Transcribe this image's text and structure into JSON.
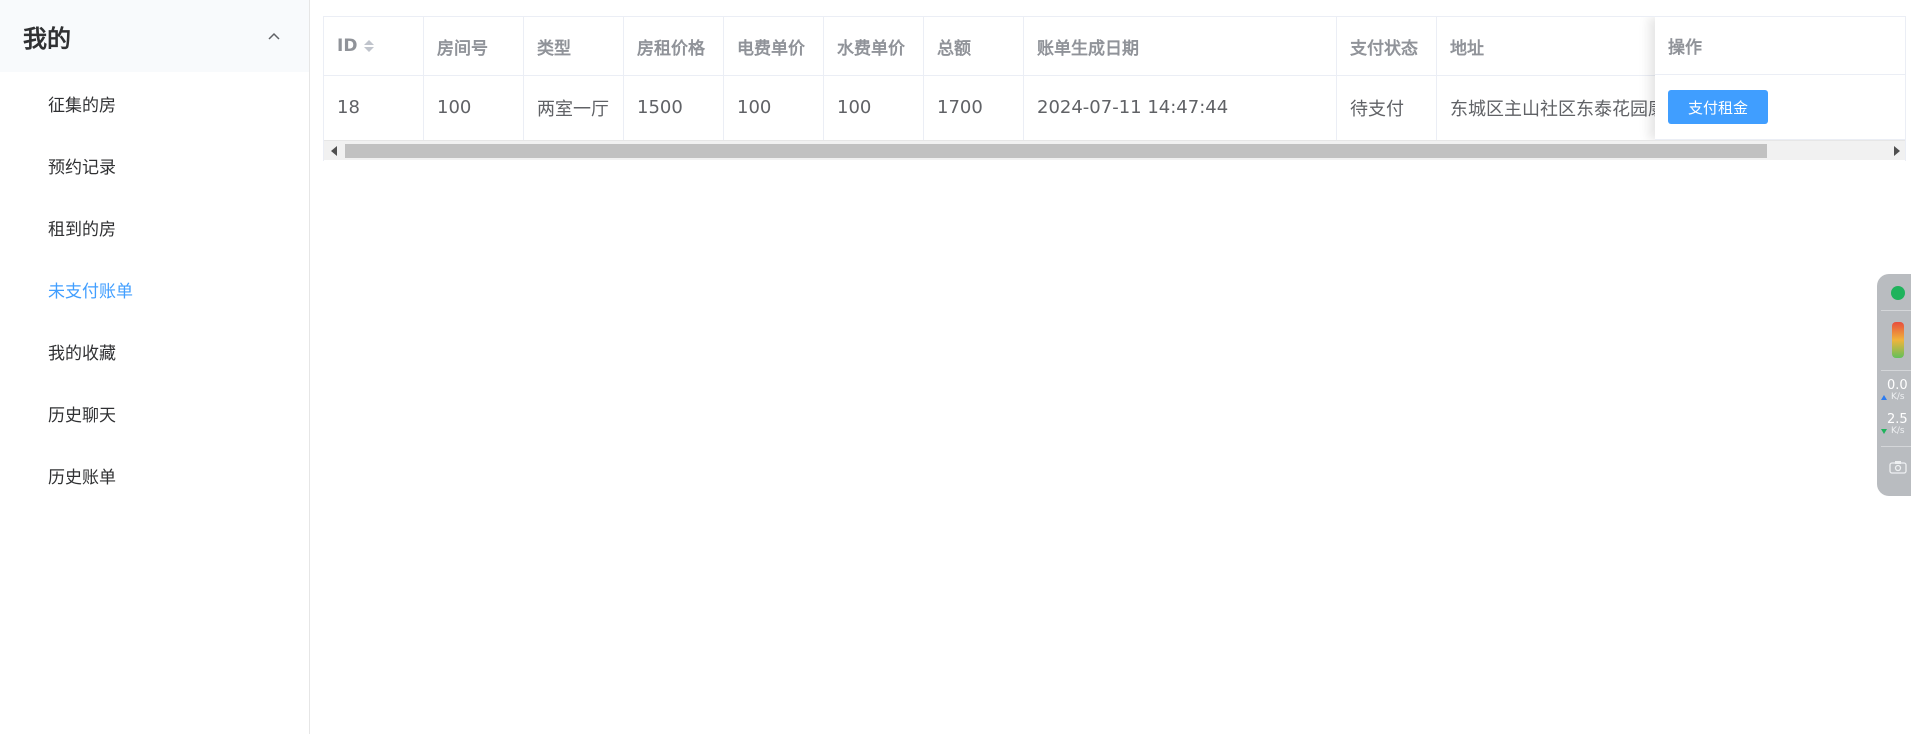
{
  "sidebar": {
    "title": "我的",
    "items": [
      {
        "label": "征集的房"
      },
      {
        "label": "预约记录"
      },
      {
        "label": "租到的房"
      },
      {
        "label": "未支付账单"
      },
      {
        "label": "我的收藏"
      },
      {
        "label": "历史聊天"
      },
      {
        "label": "历史账单"
      }
    ],
    "active_item": "未支付账单"
  },
  "table": {
    "headers": [
      "ID",
      "房间号",
      "类型",
      "房租价格",
      "电费单价",
      "水费单价",
      "总额",
      "账单生成日期",
      "支付状态",
      "地址",
      "操作"
    ],
    "rows": [
      {
        "cells": [
          "18",
          "100",
          "两室一厅",
          "1500",
          "100",
          "100",
          "1700",
          "2024-07-11 14:47:44",
          "待支付",
          "东城区主山社区东泰花园康"
        ],
        "action_label": "支付租金"
      }
    ],
    "sortable_column": "ID"
  },
  "net_widget": {
    "upload": "0.0",
    "upload_unit": "K/s",
    "download": "2.5",
    "download_unit": "K/s"
  },
  "colors": {
    "accent": "#409eff",
    "status_green": "#1fb35c"
  }
}
